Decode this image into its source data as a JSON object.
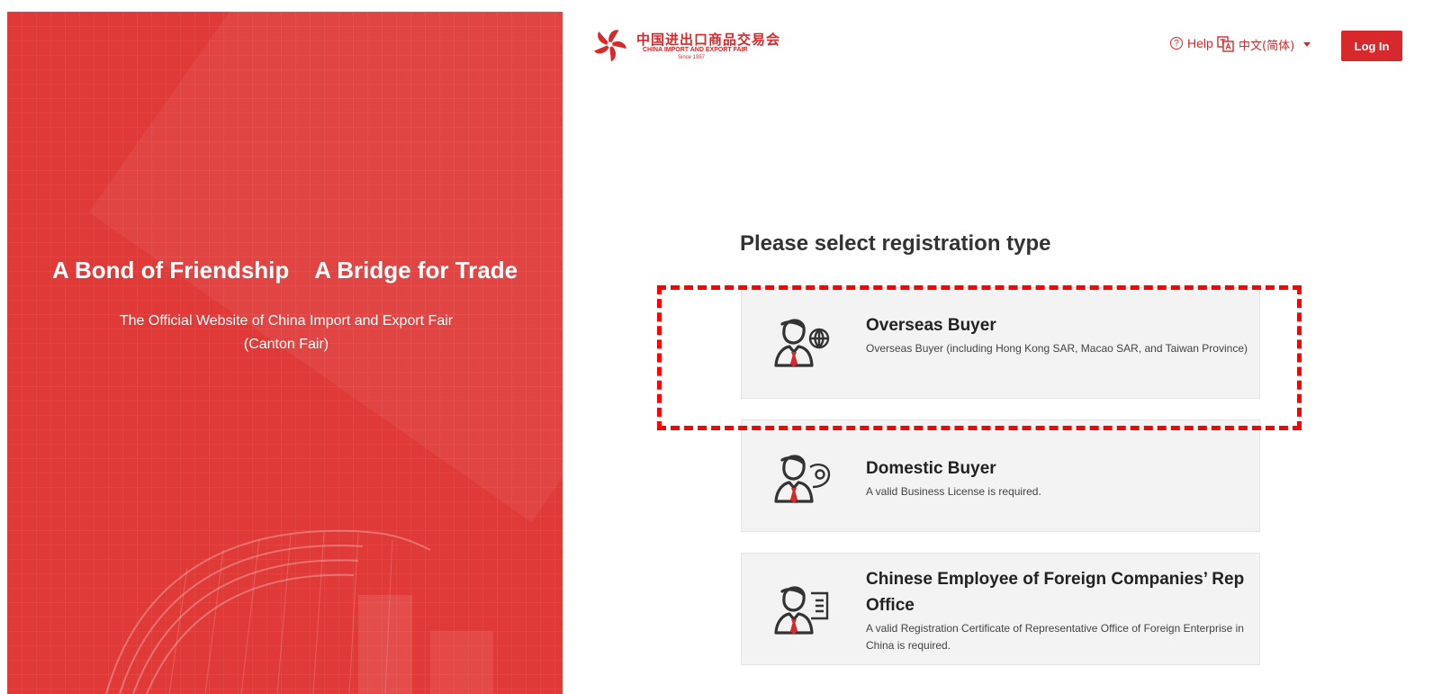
{
  "hero": {
    "title": "A Bond of Friendship    A Bridge for Trade",
    "subtitle": "The Official Website of China Import and Export Fair (Canton Fair)"
  },
  "header": {
    "logo": {
      "cn_text": "中国进出口商品交易会",
      "en_text": "CHINA IMPORT AND EXPORT FAIR",
      "since": "Since 1957"
    },
    "help_label": "Help",
    "help_icon": "question-circle",
    "language_label": "中文(简体)",
    "language_icon": "translate",
    "login_label": "Log In"
  },
  "main": {
    "title": "Please select registration type",
    "options": [
      {
        "title": "Overseas Buyer",
        "description": "Overseas Buyer (including Hong Kong SAR, Macao SAR, and Taiwan Province)",
        "icon": "buyer-globe"
      },
      {
        "title": "Domestic Buyer",
        "description": "A valid Business License is required.",
        "icon": "buyer-location"
      },
      {
        "title": "Chinese Employee of Foreign Companies’ Rep Office",
        "description": "A valid Registration Certificate of Representative Office of Foreign Enterprise in China is required.",
        "icon": "buyer-document"
      }
    ]
  },
  "colors": {
    "brand_red": "#d7282b",
    "hero_red": "#e03a38",
    "card_bg": "#f3f3f3",
    "highlight": "#ff0000"
  }
}
